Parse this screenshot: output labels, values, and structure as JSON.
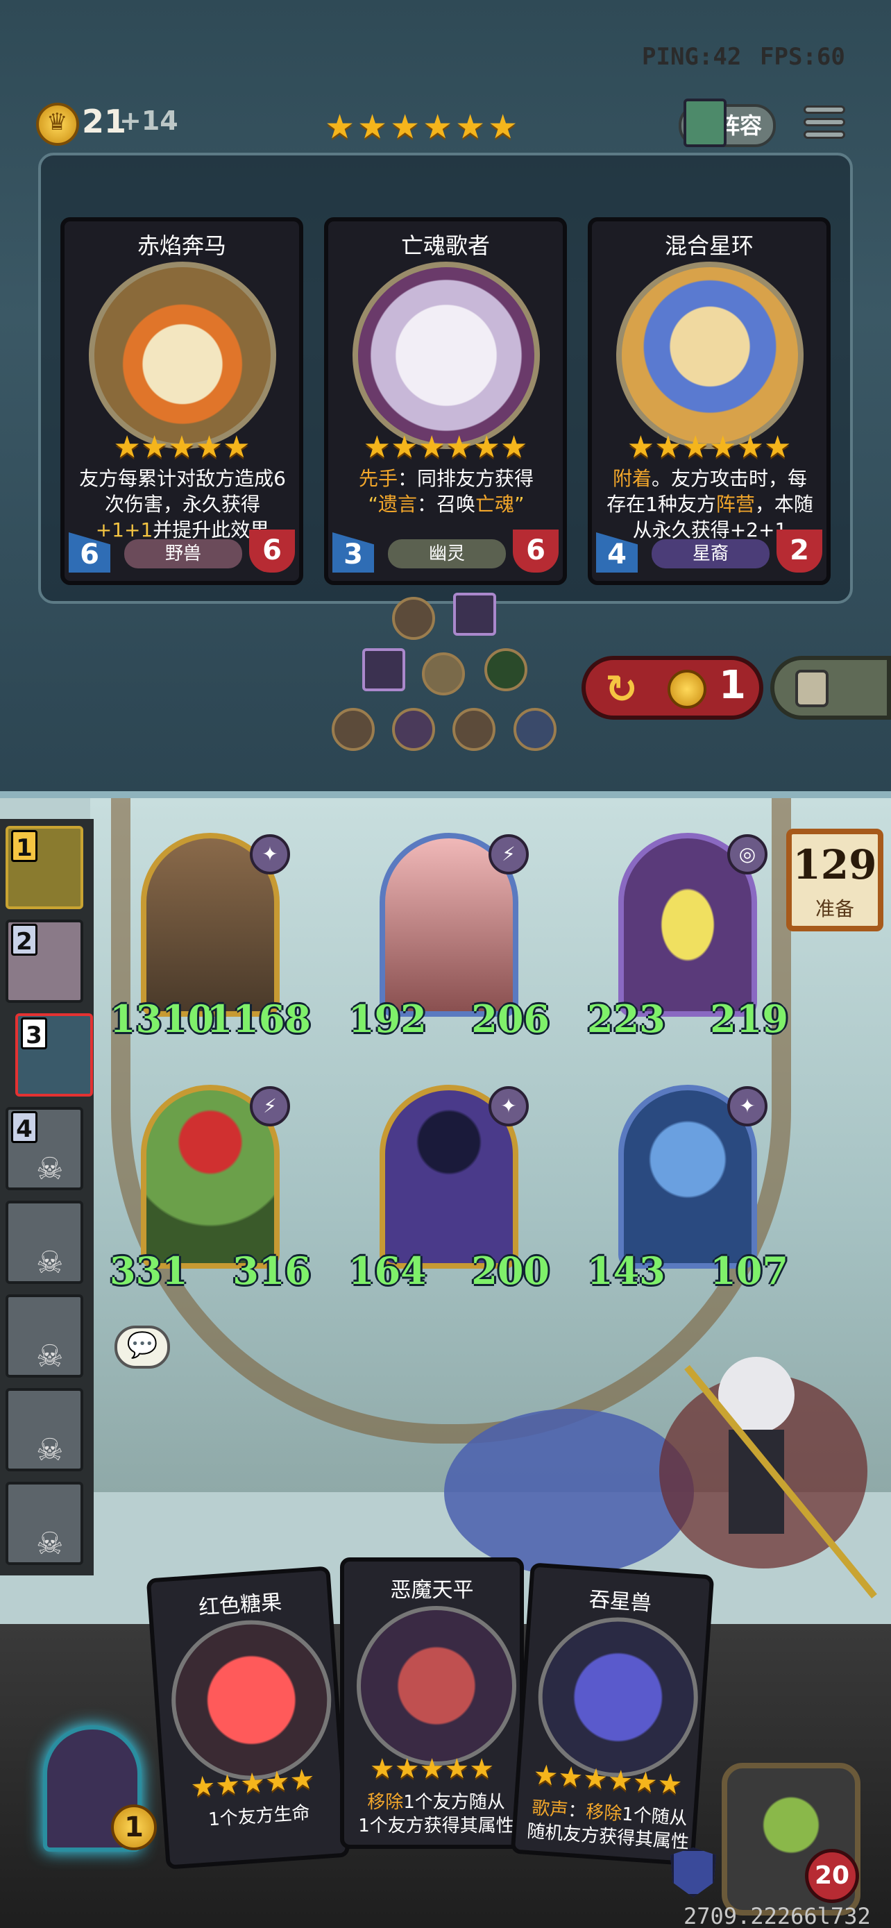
{
  "hud": {
    "ping": "PING:42",
    "fps": "FPS:60",
    "gold": "21",
    "gold_income": "+14",
    "tier_stars": "★★★★★★",
    "lineup_label": "阵容"
  },
  "shop_cards": [
    {
      "name": "赤焰奔马",
      "stars": "★★★★★",
      "desc_parts": [
        "友方每累计对敌方造成6次伤害，永久获得",
        "+1+1",
        "并提升此效果"
      ],
      "attack": "6",
      "health": "6",
      "tribe": "野兽",
      "tribe_color": "#6b4b5a",
      "art_color": "#d9c38f"
    },
    {
      "name": "亡魂歌者",
      "stars": "★★★★★★",
      "desc_keyword1": "先手",
      "desc_text1": "：同排友方获得",
      "desc_quote_open": "“",
      "desc_keyword2": "遗言",
      "desc_text2": "：召唤",
      "desc_keyword3": "亡魂",
      "desc_quote_close": "”",
      "attack": "3",
      "health": "6",
      "tribe": "幽灵",
      "tribe_color": "#5b6150",
      "art_color": "#e8e4ef"
    },
    {
      "name": "混合星环",
      "stars": "★★★★★★",
      "desc_keyword1": "附着",
      "desc_text1": "。友方攻击时，每存在1种友方",
      "desc_keyword2": "阵营",
      "desc_text2": "，本随从永久获得+2+1",
      "attack": "4",
      "health": "2",
      "tribe": "星裔",
      "tribe_color": "#4b3d78",
      "art_color": "#e8b24a"
    }
  ],
  "reroll": {
    "arrow": "↻",
    "cost": "1"
  },
  "board": {
    "minions": [
      {
        "attack": "1310",
        "health": "1168",
        "badge": "✦",
        "art_color": "#7a6040"
      },
      {
        "attack": "192",
        "health": "206",
        "badge": "⚡",
        "art_color": "#e8a0a0"
      },
      {
        "attack": "223",
        "health": "219",
        "badge": "◎",
        "art_color": "#5a3a7a"
      },
      {
        "attack": "331",
        "health": "316",
        "badge": "⚡",
        "art_color": "#6ba04a"
      },
      {
        "attack": "164",
        "health": "200",
        "badge": "✦",
        "art_color": "#4a3a8a"
      },
      {
        "attack": "143",
        "health": "107",
        "badge": "✦",
        "art_color": "#4a6aa0"
      }
    ],
    "timer": "129",
    "timer_label": "准备"
  },
  "leaderboard": {
    "players": [
      {
        "rank": "1",
        "status": "top"
      },
      {
        "rank": "2",
        "status": "normal"
      },
      {
        "rank": "3",
        "status": "current"
      },
      {
        "rank": "4",
        "status": "eliminated"
      },
      {
        "rank": "",
        "status": "eliminated"
      },
      {
        "rank": "",
        "status": "eliminated"
      },
      {
        "rank": "",
        "status": "eliminated"
      },
      {
        "rank": "",
        "status": "eliminated"
      }
    ],
    "skull": "☠"
  },
  "hand_cards": [
    {
      "name": "红色糖果",
      "stars": "★★★★★",
      "desc_text": "1个友方生命",
      "art_color": "#e0303a"
    },
    {
      "name": "恶魔天平",
      "stars": "★★★★★",
      "desc_keyword": "移除",
      "desc_text1": "1个友方随从",
      "desc_text2": "1个友方获得其属性",
      "art_color": "#b04040"
    },
    {
      "name": "吞星兽",
      "stars": "★★★★★★",
      "desc_keyword1": "歌声",
      "desc_text1": "：",
      "desc_keyword2": "移除",
      "desc_text2": "1个随从",
      "desc_text3": "随机友方获得其属性",
      "art_color": "#3a3a88"
    }
  ],
  "player": {
    "spellbook_count": "1",
    "health": "20",
    "build_version": "2709.22266l732"
  },
  "chat_icon": "💬"
}
